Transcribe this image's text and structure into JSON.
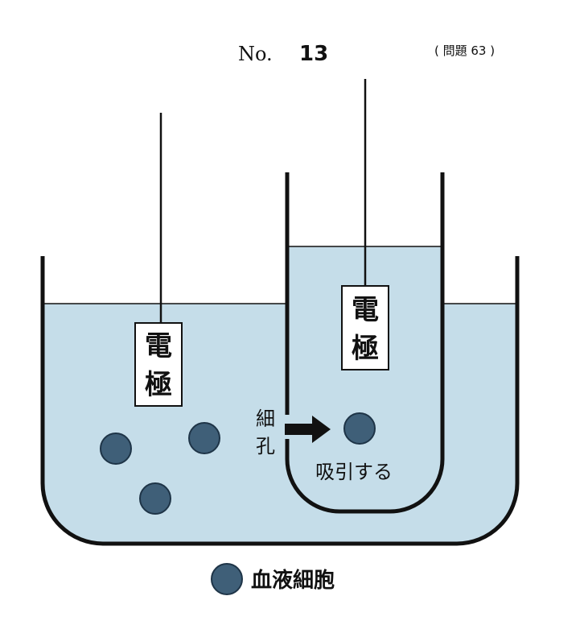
{
  "header": {
    "no_prefix": "No.",
    "no_value": "13",
    "question_ref": "( 問題 63 )"
  },
  "outer_electrode": {
    "label_line1": "電",
    "label_line2": "極"
  },
  "inner_electrode": {
    "label_line1": "電",
    "label_line2": "極"
  },
  "pore": {
    "label_line1": "細",
    "label_line2": "孔"
  },
  "suction_text": "吸引する",
  "legend": {
    "label": "血液細胞"
  },
  "colors": {
    "liquid": "#c5dde9",
    "wall": "#111111",
    "cell_fill": "#3f5f78",
    "cell_stroke": "#1e3447",
    "label_box": "#ffffff"
  }
}
